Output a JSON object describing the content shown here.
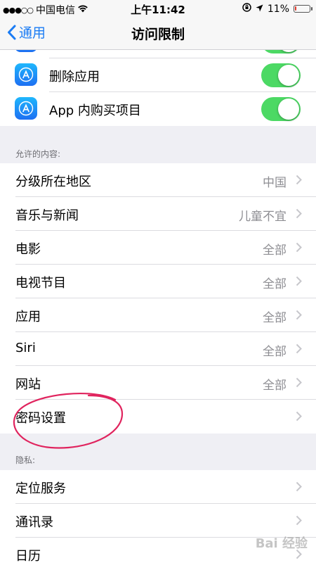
{
  "status_bar": {
    "carrier": "中国电信",
    "time": "上午11:42",
    "battery_percent": "11%",
    "battery_level": 0.11
  },
  "nav": {
    "back_label": "通用",
    "title": "访问限制"
  },
  "top_group": {
    "rows": [
      {
        "label": "删除应用",
        "toggle_on": true,
        "icon": "app-store-icon"
      },
      {
        "label": "App 内购买项目",
        "toggle_on": true,
        "icon": "app-store-icon"
      }
    ]
  },
  "allowed_content": {
    "header": "允许的内容:",
    "rows": [
      {
        "label": "分级所在地区",
        "value": "中国"
      },
      {
        "label": "音乐与新闻",
        "value": "儿童不宜"
      },
      {
        "label": "电影",
        "value": "全部"
      },
      {
        "label": "电视节目",
        "value": "全部"
      },
      {
        "label": "应用",
        "value": "全部"
      },
      {
        "label": "Siri",
        "value": "全部"
      },
      {
        "label": "网站",
        "value": "全部"
      },
      {
        "label": "密码设置",
        "value": ""
      }
    ]
  },
  "privacy": {
    "header": "隐私:",
    "rows": [
      {
        "label": "定位服务"
      },
      {
        "label": "通讯录"
      },
      {
        "label": "日历"
      }
    ]
  },
  "watermark": "Bai 经验",
  "colors": {
    "accent": "#1b7cf4",
    "toggle_on": "#4cd964",
    "annotation": "#e0245e"
  }
}
